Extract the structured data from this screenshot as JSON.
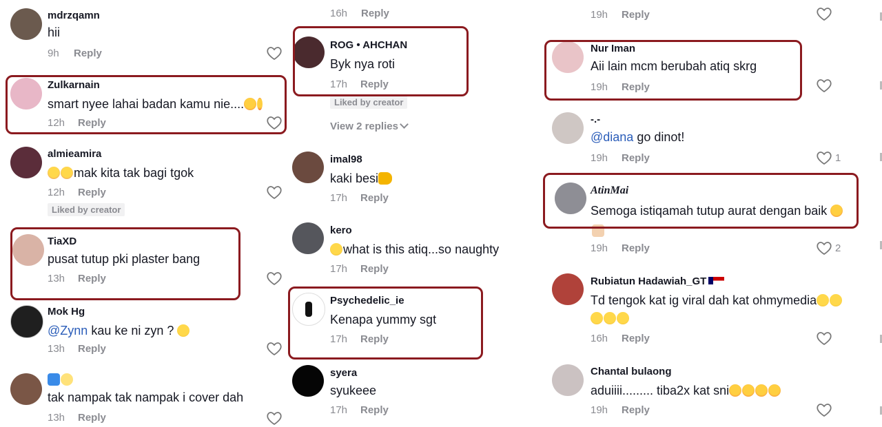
{
  "columns": [
    {
      "comments": [
        {
          "user": "mdrzqamn",
          "text": "hii",
          "time": "9h",
          "reply": "Reply",
          "avatar_color": "#6b5a4e"
        },
        {
          "user": "Zulkarnain",
          "text": "smart nyee lahai badan kamu nie....",
          "time": "12h",
          "reply": "Reply",
          "avatar_color": "#e8b7c7"
        },
        {
          "user": "almieamira",
          "text": "mak kita tak bagi tgok",
          "time": "12h",
          "reply": "Reply",
          "liked_by": "Liked by creator",
          "avatar_color": "#5b2d3a"
        },
        {
          "user": "TiaXD",
          "text": "pusat tutup pki plaster bang",
          "time": "13h",
          "reply": "Reply",
          "avatar_color": "#d9b3a6"
        },
        {
          "user": "Mok Hg",
          "mention": "@Zynn",
          "text": "kau ke ni zyn ?",
          "time": "13h",
          "reply": "Reply",
          "avatar_color": "#1f1f1f"
        },
        {
          "user": "",
          "text": "tak nampak tak nampak i cover dah",
          "time": "13h",
          "reply": "Reply",
          "avatar_color": "#7a5646"
        }
      ]
    },
    {
      "comments": [
        {
          "time": "16h",
          "reply": "Reply"
        },
        {
          "user": "ROG • AHCHAN",
          "text": "Byk nya roti",
          "time": "17h",
          "reply": "Reply",
          "liked_by": "Liked by creator",
          "view_replies": "View 2 replies",
          "avatar_color": "#4a2a2e"
        },
        {
          "user": "imal98",
          "text": "kaki besi",
          "time": "17h",
          "reply": "Reply",
          "avatar_color": "#6b4a3f"
        },
        {
          "user": "kero",
          "text": "what is this atiq...so naughty",
          "time": "17h",
          "reply": "Reply",
          "avatar_color": "#55565c"
        },
        {
          "user": "Psychedelic_ie",
          "text": "Kenapa yummy sgt",
          "time": "17h",
          "reply": "Reply",
          "avatar_color": "#ffffff"
        },
        {
          "user": "syera",
          "text": "syukeee",
          "time": "17h",
          "reply": "Reply",
          "avatar_color": "#050505"
        }
      ]
    },
    {
      "comments": [
        {
          "time": "19h",
          "reply": "Reply"
        },
        {
          "user": "Nur Iman",
          "text": "Aii lain mcm berubah atiq skrg",
          "time": "19h",
          "reply": "Reply",
          "avatar_color": "#e9c4c8"
        },
        {
          "user": "-.-",
          "mention": "@diana",
          "text": "go dinot!",
          "time": "19h",
          "reply": "Reply",
          "likes": "1",
          "avatar_color": "#cfc7c4"
        },
        {
          "user": "AtinMai",
          "text": "Semoga istiqamah tutup aurat dengan baik",
          "time": "19h",
          "reply": "Reply",
          "likes": "2",
          "avatar_color": "#8e8e95"
        },
        {
          "user": "Rubiatun Hadawiah_GT",
          "text": "Td tengok kat ig viral dah kat ohmymedia",
          "time": "16h",
          "reply": "Reply",
          "avatar_color": "#b0423a"
        },
        {
          "user": "Chantal bulaong",
          "text": "aduiiii......... tiba2x kat sni",
          "time": "19h",
          "reply": "Reply",
          "avatar_color": "#cbc2c2"
        }
      ]
    }
  ]
}
